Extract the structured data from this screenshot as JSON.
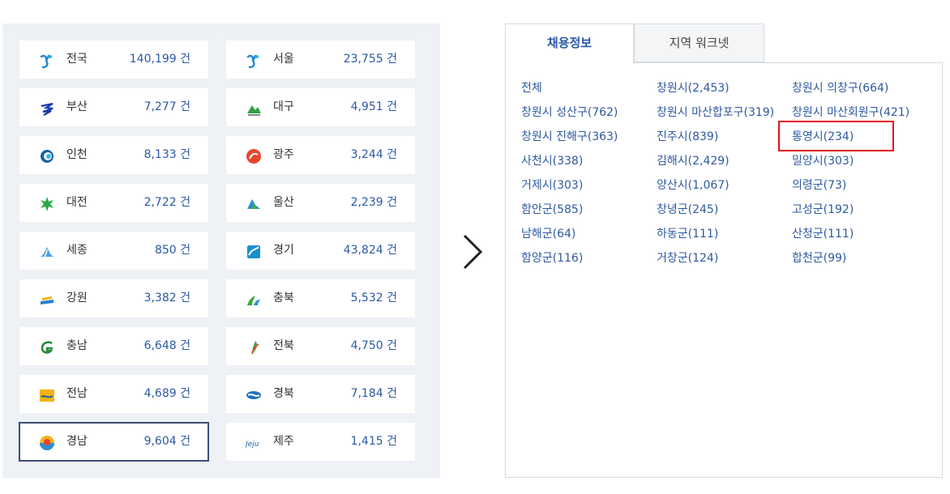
{
  "regions": [
    {
      "name": "전국",
      "count": "140,199 건",
      "logo": "national-logo-icon"
    },
    {
      "name": "서울",
      "count": "23,755 건",
      "logo": "seoul-logo-icon"
    },
    {
      "name": "부산",
      "count": "7,277 건",
      "logo": "busan-logo-icon"
    },
    {
      "name": "대구",
      "count": "4,951 건",
      "logo": "daegu-logo-icon"
    },
    {
      "name": "인천",
      "count": "8,133 건",
      "logo": "incheon-logo-icon"
    },
    {
      "name": "광주",
      "count": "3,244 건",
      "logo": "gwangju-logo-icon"
    },
    {
      "name": "대전",
      "count": "2,722 건",
      "logo": "daejeon-logo-icon"
    },
    {
      "name": "울산",
      "count": "2,239 건",
      "logo": "ulsan-logo-icon"
    },
    {
      "name": "세종",
      "count": "850 건",
      "logo": "sejong-logo-icon"
    },
    {
      "name": "경기",
      "count": "43,824 건",
      "logo": "gyeonggi-logo-icon"
    },
    {
      "name": "강원",
      "count": "3,382 건",
      "logo": "gangwon-logo-icon"
    },
    {
      "name": "충북",
      "count": "5,532 건",
      "logo": "chungbuk-logo-icon"
    },
    {
      "name": "충남",
      "count": "6,648 건",
      "logo": "chungnam-logo-icon"
    },
    {
      "name": "전북",
      "count": "4,750 건",
      "logo": "jeonbuk-logo-icon"
    },
    {
      "name": "전남",
      "count": "4,689 건",
      "logo": "jeonnam-logo-icon"
    },
    {
      "name": "경북",
      "count": "7,184 건",
      "logo": "gyeongbuk-logo-icon"
    },
    {
      "name": "경남",
      "count": "9,604 건",
      "logo": "gyeongnam-logo-icon",
      "selected": true
    },
    {
      "name": "제주",
      "count": "1,415 건",
      "logo": "jeju-logo-icon"
    }
  ],
  "tabs": {
    "active": "채용정보",
    "inactive": "지역 워크넷"
  },
  "cities": [
    "전체",
    "창원시(2,453)",
    "창원시 의창구(664)",
    "창원시 성산구(762)",
    "창원시 마산합포구(319)",
    "창원시 마산회원구(421)",
    "창원시 진해구(363)",
    "진주시(839)",
    "통영시(234)",
    "사천시(338)",
    "김해시(2,429)",
    "밀양시(303)",
    "거제시(303)",
    "양산시(1,067)",
    "의령군(73)",
    "함안군(585)",
    "창녕군(245)",
    "고성군(192)",
    "남해군(64)",
    "하동군(111)",
    "산청군(111)",
    "함양군(116)",
    "거창군(124)",
    "합천군(99)"
  ],
  "highlighted_city": "통영시(234)",
  "colors": {
    "panel_bg": "#eef1f5",
    "count_text": "#2b58a6",
    "link_text": "#2e5aa0",
    "highlight": "#e0101c",
    "selected_border": "#3d4f77"
  },
  "icons": {
    "arrow": "chevron-right-icon"
  }
}
